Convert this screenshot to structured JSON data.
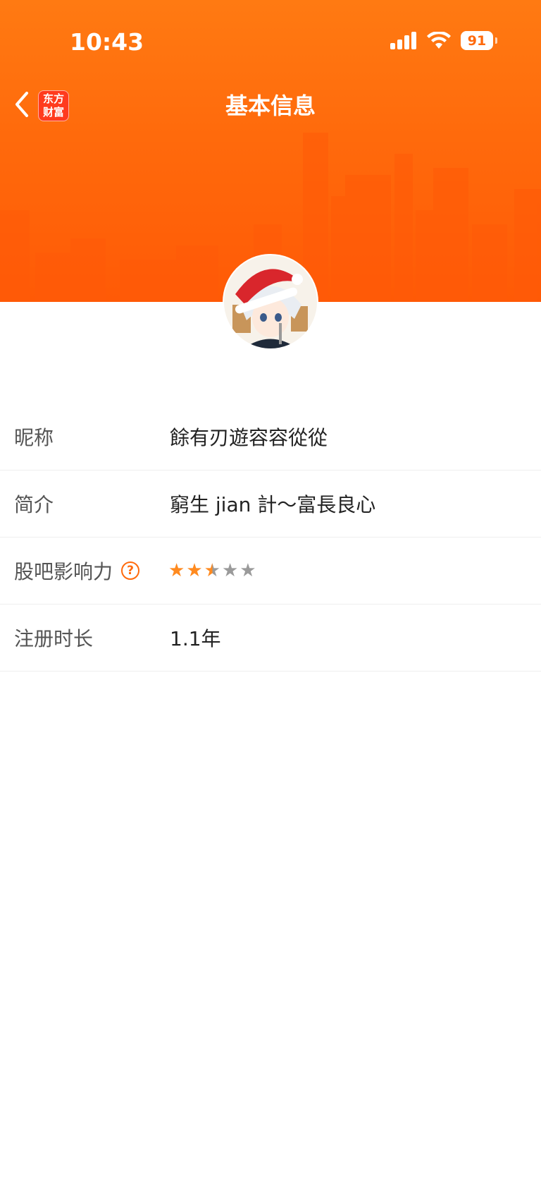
{
  "status_bar": {
    "time": "10:43",
    "battery": "91"
  },
  "nav": {
    "title": "基本信息",
    "logo_line1": "东方",
    "logo_line2": "财富"
  },
  "profile": {
    "rows": [
      {
        "label": "昵称",
        "value": "餘有刃遊容容從從"
      },
      {
        "label": "简介",
        "value": "窮生 jian 計～富長良心"
      },
      {
        "label": "股吧影响力",
        "rating": 2.5,
        "rating_max": 5
      },
      {
        "label": "注册时长",
        "value": "1.1年"
      }
    ]
  },
  "colors": {
    "brand": "#ff6a0c",
    "star_on": "#ff8a1f",
    "star_off": "#9a9a9a"
  }
}
